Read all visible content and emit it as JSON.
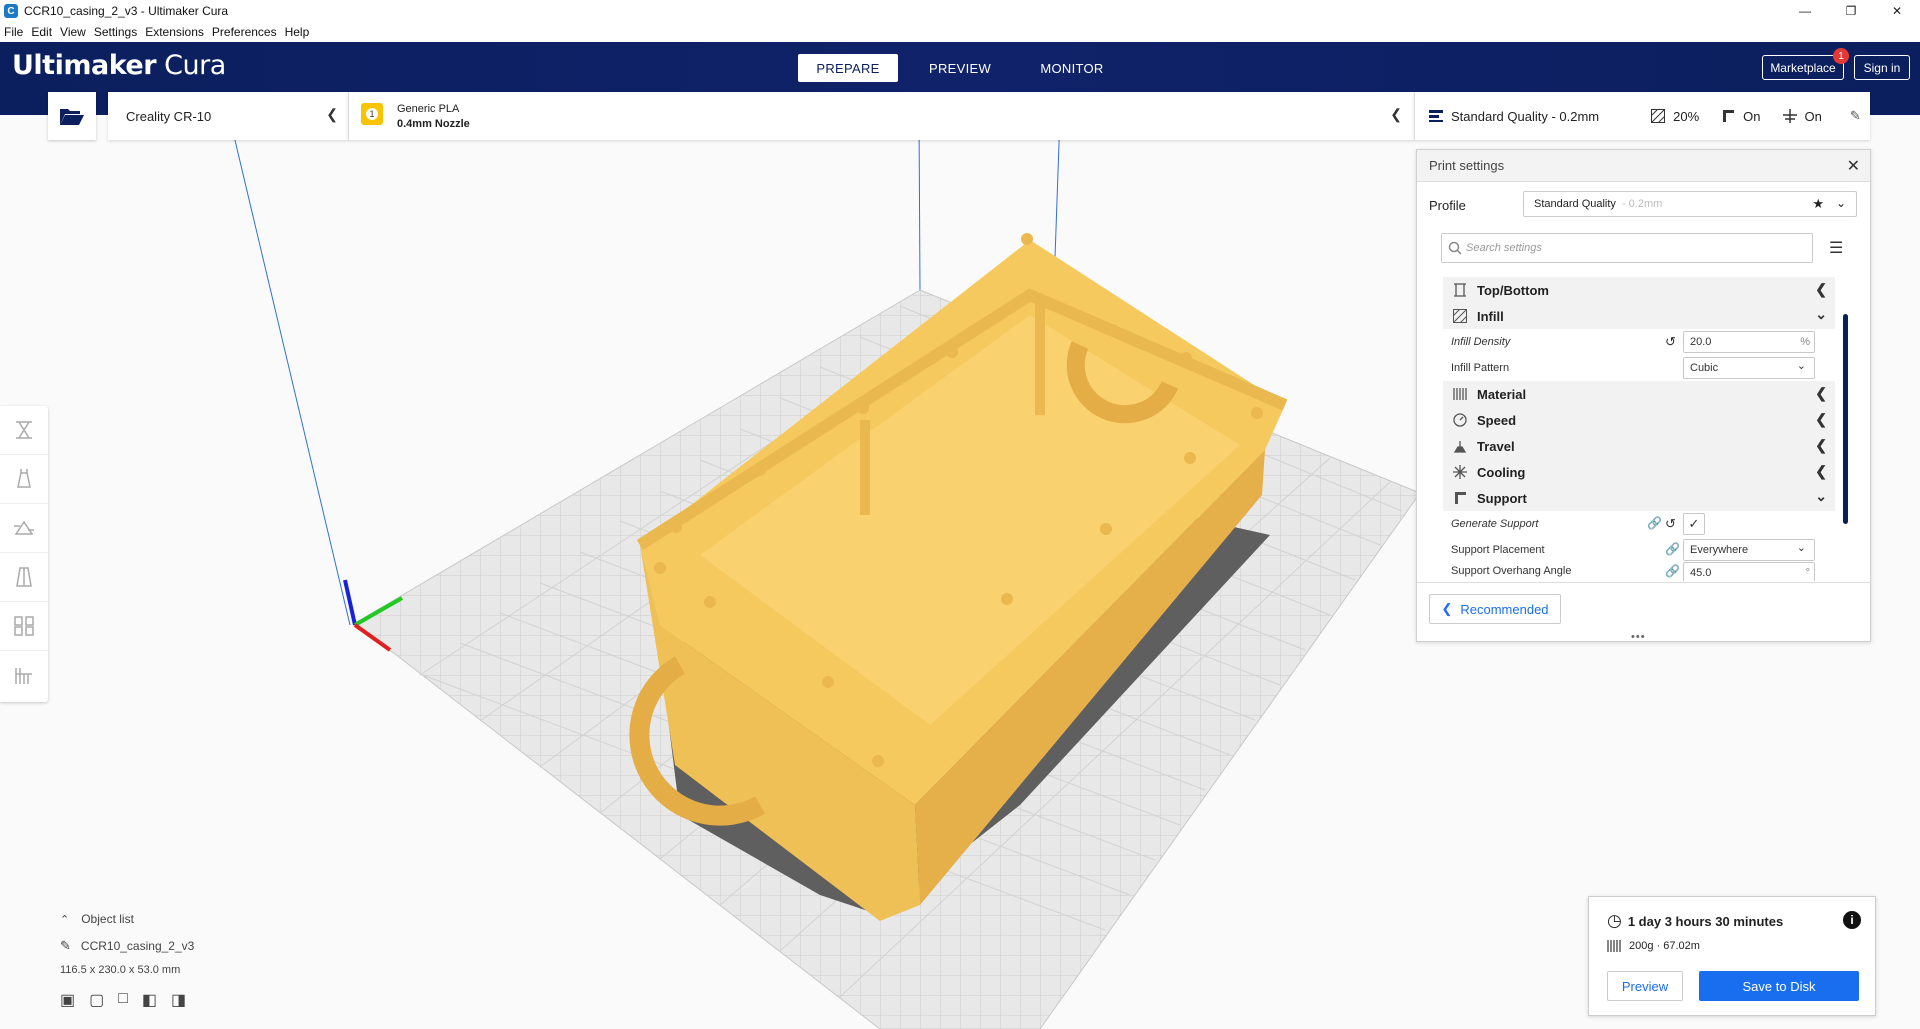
{
  "window": {
    "title": "CCR10_casing_2_v3 - Ultimaker Cura"
  },
  "menu": [
    "File",
    "Edit",
    "View",
    "Settings",
    "Extensions",
    "Preferences",
    "Help"
  ],
  "header": {
    "logo_bold": "Ultimaker",
    "logo_light": "Cura",
    "tabs": [
      "PREPARE",
      "PREVIEW",
      "MONITOR"
    ],
    "marketplace": "Marketplace",
    "marketplace_badge": "1",
    "signin": "Sign in"
  },
  "printer": {
    "name": "Creality CR-10"
  },
  "material": {
    "slot": "1",
    "name": "Generic PLA",
    "nozzle": "0.4mm Nozzle"
  },
  "quality": {
    "profile": "Standard Quality - 0.2mm",
    "infill": "20%",
    "support": "On",
    "adhesion": "On"
  },
  "print_settings": {
    "title": "Print settings",
    "profile_label": "Profile",
    "profile_value": "Standard Quality",
    "profile_suffix": "- 0.2mm",
    "search_placeholder": "Search settings",
    "categories": {
      "top_bottom": "Top/Bottom",
      "infill": "Infill",
      "material": "Material",
      "speed": "Speed",
      "travel": "Travel",
      "cooling": "Cooling",
      "support": "Support"
    },
    "infill_density_label": "Infill Density",
    "infill_density_value": "20.0",
    "infill_density_unit": "%",
    "infill_pattern_label": "Infill Pattern",
    "infill_pattern_value": "Cubic",
    "generate_support_label": "Generate Support",
    "support_placement_label": "Support Placement",
    "support_placement_value": "Everywhere",
    "support_angle_label": "Support Overhang Angle",
    "support_angle_value": "45.0",
    "support_angle_unit": "°",
    "recommended": "Recommended"
  },
  "object_list": {
    "title": "Object list",
    "name": "CCR10_casing_2_v3",
    "dimensions": "116.5 x 230.0 x 53.0 mm"
  },
  "job": {
    "time": "1 day 3 hours 30 minutes",
    "material": "200g · 67.02m",
    "preview": "Preview",
    "save": "Save to Disk"
  },
  "colors": {
    "accent": "#196ef0",
    "header": "#0b1f5e",
    "model": "#f9d16f"
  }
}
